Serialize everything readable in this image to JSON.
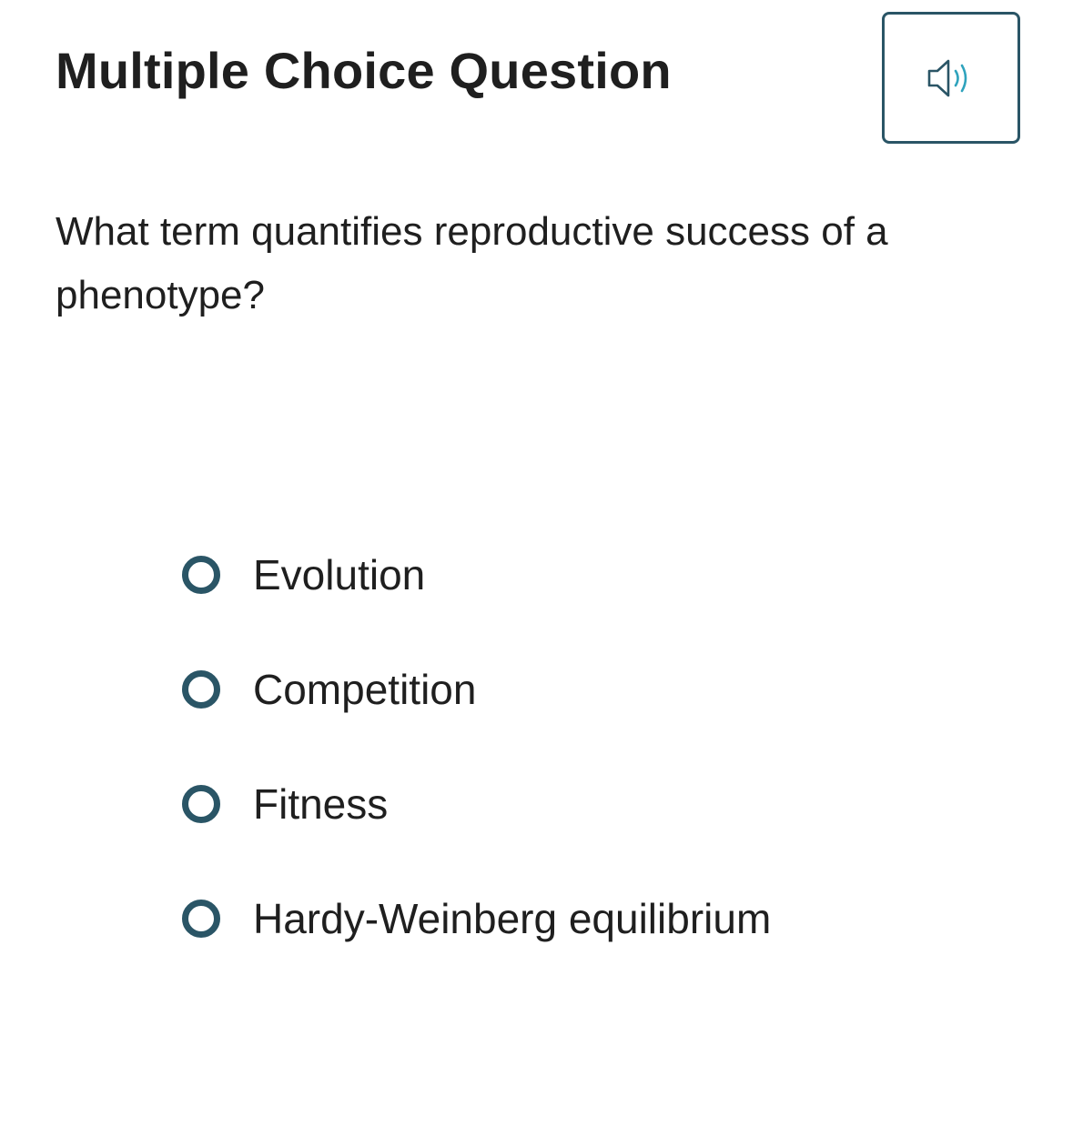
{
  "header": {
    "title": "Multiple Choice Question",
    "audio_icon": "speaker-sound-icon"
  },
  "question": {
    "text": "What term quantifies reproductive success of a phenotype?"
  },
  "options": [
    {
      "label": "Evolution",
      "selected": false
    },
    {
      "label": "Competition",
      "selected": false
    },
    {
      "label": "Fitness",
      "selected": false
    },
    {
      "label": "Hardy-Weinberg equilibrium",
      "selected": false
    }
  ],
  "colors": {
    "accent": "#2a5566",
    "sound_waves": "#2fa3bd",
    "text": "#1f1f1f"
  }
}
